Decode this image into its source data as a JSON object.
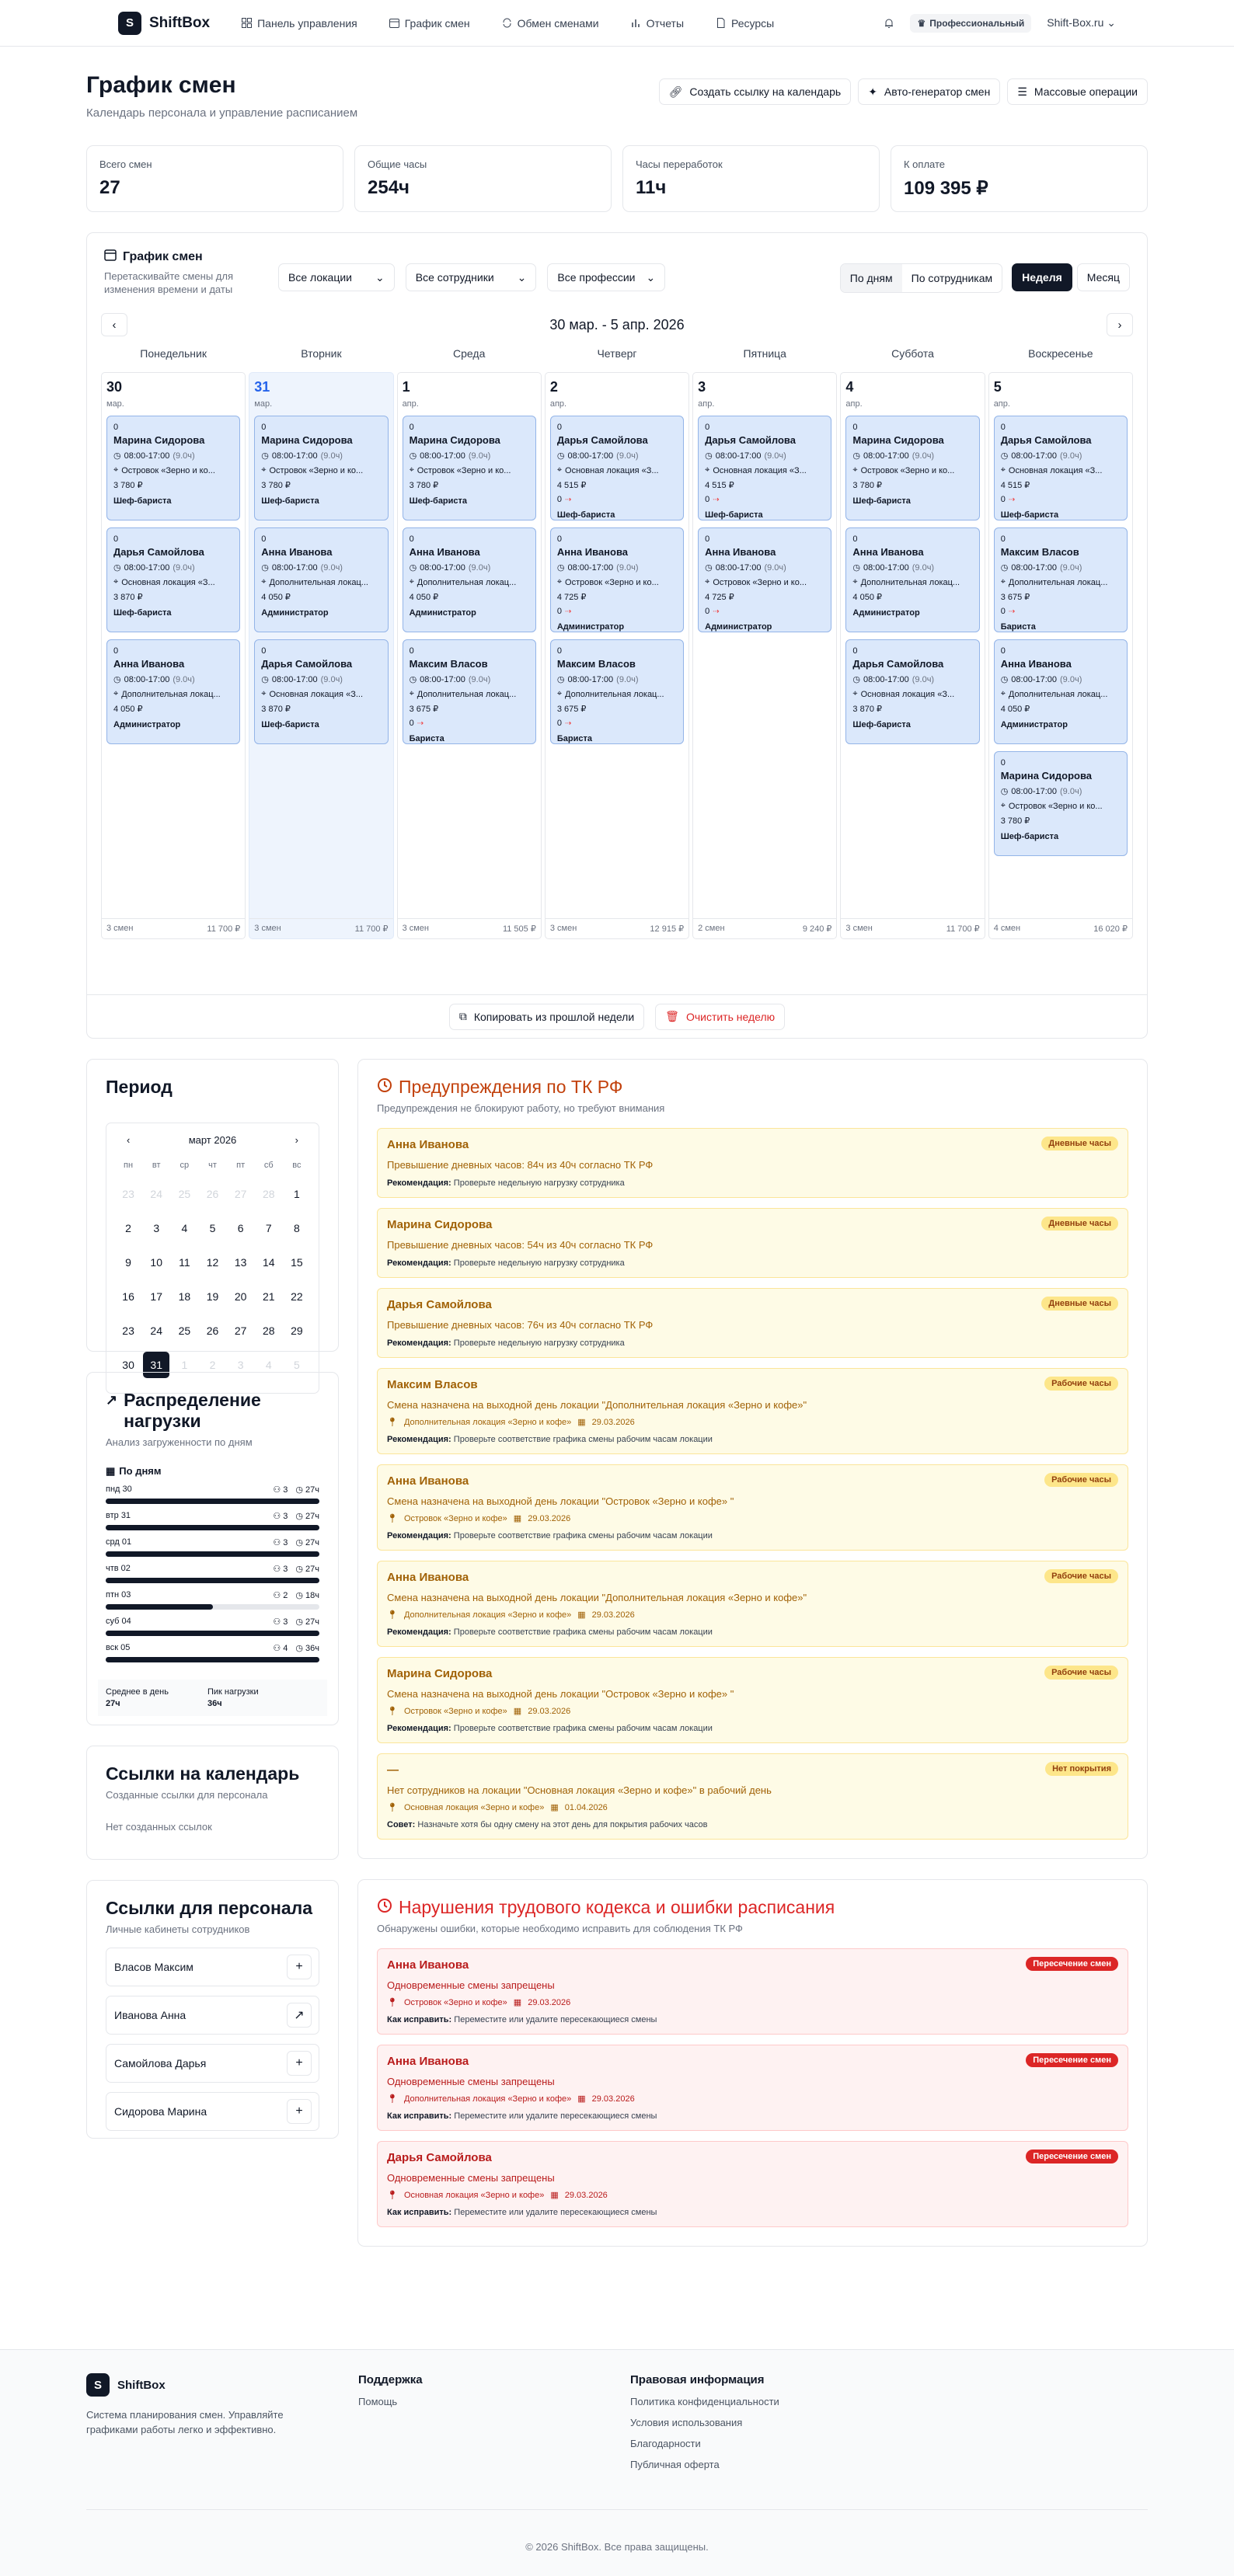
{
  "brand": {
    "name": "ShiftBox",
    "letter": "S"
  },
  "nav": [
    {
      "icon": "grid-icon",
      "label": "Панель управления"
    },
    {
      "icon": "calendar-icon",
      "label": "График смен"
    },
    {
      "icon": "swap-icon",
      "label": "Обмен сменами"
    },
    {
      "icon": "chart-icon",
      "label": "Отчеты"
    },
    {
      "icon": "doc-icon",
      "label": "Ресурсы"
    }
  ],
  "header": {
    "plan": "Профессиональный",
    "account": "Shift-Box.ru"
  },
  "page": {
    "title": "График смен",
    "subtitle": "Календарь персонала и управление расписанием"
  },
  "actions": {
    "link": "Создать ссылку на календарь",
    "generator": "Авто-генератор смен",
    "bulk": "Массовые операции"
  },
  "stats": [
    {
      "label": "Всего смен",
      "value": "27"
    },
    {
      "label": "Общие часы",
      "value": "254ч"
    },
    {
      "label": "Часы переработок",
      "value": "11ч"
    },
    {
      "label": "К оплате",
      "value": "109 395 ₽"
    }
  ],
  "schedule": {
    "title": "График смен",
    "desc": "Перетаскивайте смены для изменения времени и даты",
    "filters": {
      "locations": "Все локации",
      "staff": "Все сотрудники",
      "professions": "Все профессии"
    },
    "views": {
      "by_days": "По дням",
      "by_staff": "По сотрудникам",
      "week": "Неделя",
      "month": "Месяц"
    },
    "week_label": "30 мар. - 5 апр. 2026",
    "day_names": [
      "Понедельник",
      "Вторник",
      "Среда",
      "Четверг",
      "Пятница",
      "Суббота",
      "Воскресенье"
    ],
    "copy_label": "Копировать из прошлой недели",
    "clear_label": "Очистить неделю"
  },
  "days": [
    {
      "num": "30",
      "month": "мар.",
      "count": "3 смен",
      "total": "11 700 ₽",
      "shifts": [
        {
          "n": "0",
          "name": "Марина Сидорова",
          "time": "08:00-17:00",
          "dur": "(9.0ч)",
          "loc": "Островок «Зерно и ко...",
          "price": "3 780 ₽",
          "role": "Шеф-бариста"
        },
        {
          "n": "0",
          "name": "Дарья Самойлова",
          "time": "08:00-17:00",
          "dur": "(9.0ч)",
          "loc": "Основная локация «З...",
          "price": "3 870 ₽",
          "role": "Шеф-бариста"
        },
        {
          "n": "0",
          "name": "Анна Иванова",
          "time": "08:00-17:00",
          "dur": "(9.0ч)",
          "loc": "Дополнительная локац...",
          "price": "4 050 ₽",
          "role": "Администратор"
        }
      ]
    },
    {
      "num": "31",
      "month": "мар.",
      "count": "3 смен",
      "total": "11 700 ₽",
      "shifts": [
        {
          "n": "0",
          "name": "Марина Сидорова",
          "time": "08:00-17:00",
          "dur": "(9.0ч)",
          "loc": "Островок «Зерно и ко...",
          "price": "3 780 ₽",
          "role": "Шеф-бариста"
        },
        {
          "n": "0",
          "name": "Анна Иванова",
          "time": "08:00-17:00",
          "dur": "(9.0ч)",
          "loc": "Дополнительная локац...",
          "price": "4 050 ₽",
          "role": "Администратор"
        },
        {
          "n": "0",
          "name": "Дарья Самойлова",
          "time": "08:00-17:00",
          "dur": "(9.0ч)",
          "loc": "Основная локация «З...",
          "price": "3 870 ₽",
          "role": "Шеф-бариста"
        }
      ]
    },
    {
      "num": "1",
      "month": "апр.",
      "count": "3 смен",
      "total": "11 505 ₽",
      "shifts": [
        {
          "n": "0",
          "name": "Марина Сидорова",
          "time": "08:00-17:00",
          "dur": "(9.0ч)",
          "loc": "Островок «Зерно и ко...",
          "price": "3 780 ₽",
          "role": "Шеф-бариста"
        },
        {
          "n": "0",
          "name": "Анна Иванова",
          "time": "08:00-17:00",
          "dur": "(9.0ч)",
          "loc": "Дополнительная локац...",
          "price": "4 050 ₽",
          "role": "Администратор"
        },
        {
          "n": "0",
          "name": "Максим Власов",
          "time": "08:00-17:00",
          "dur": "(9.0ч)",
          "loc": "Дополнительная локац...",
          "price": "3 675 ₽",
          "extra": "0",
          "role": "Бариста"
        }
      ]
    },
    {
      "num": "2",
      "month": "апр.",
      "count": "3 смен",
      "total": "12 915 ₽",
      "shifts": [
        {
          "n": "0",
          "name": "Дарья Самойлова",
          "time": "08:00-17:00",
          "dur": "(9.0ч)",
          "loc": "Основная локация «З...",
          "price": "4 515 ₽",
          "extra": "0",
          "role": "Шеф-бариста"
        },
        {
          "n": "0",
          "name": "Анна Иванова",
          "time": "08:00-17:00",
          "dur": "(9.0ч)",
          "loc": "Островок «Зерно и ко...",
          "price": "4 725 ₽",
          "extra": "0",
          "role": "Администратор"
        },
        {
          "n": "0",
          "name": "Максим Власов",
          "time": "08:00-17:00",
          "dur": "(9.0ч)",
          "loc": "Дополнительная локац...",
          "price": "3 675 ₽",
          "extra": "0",
          "role": "Бариста"
        }
      ]
    },
    {
      "num": "3",
      "month": "апр.",
      "count": "2 смен",
      "total": "9 240 ₽",
      "shifts": [
        {
          "n": "0",
          "name": "Дарья Самойлова",
          "time": "08:00-17:00",
          "dur": "(9.0ч)",
          "loc": "Основная локация «З...",
          "price": "4 515 ₽",
          "extra": "0",
          "role": "Шеф-бариста"
        },
        {
          "n": "0",
          "name": "Анна Иванова",
          "time": "08:00-17:00",
          "dur": "(9.0ч)",
          "loc": "Островок «Зерно и ко...",
          "price": "4 725 ₽",
          "extra": "0",
          "role": "Администратор"
        }
      ]
    },
    {
      "num": "4",
      "month": "апр.",
      "count": "3 смен",
      "total": "11 700 ₽",
      "shifts": [
        {
          "n": "0",
          "name": "Марина Сидорова",
          "time": "08:00-17:00",
          "dur": "(9.0ч)",
          "loc": "Островок «Зерно и ко...",
          "price": "3 780 ₽",
          "role": "Шеф-бариста"
        },
        {
          "n": "0",
          "name": "Анна Иванова",
          "time": "08:00-17:00",
          "dur": "(9.0ч)",
          "loc": "Дополнительная локац...",
          "price": "4 050 ₽",
          "role": "Администратор"
        },
        {
          "n": "0",
          "name": "Дарья Самойлова",
          "time": "08:00-17:00",
          "dur": "(9.0ч)",
          "loc": "Основная локация «З...",
          "price": "3 870 ₽",
          "role": "Шеф-бариста"
        }
      ]
    },
    {
      "num": "5",
      "month": "апр.",
      "count": "4 смен",
      "total": "16 020 ₽",
      "shifts": [
        {
          "n": "0",
          "name": "Дарья Самойлова",
          "time": "08:00-17:00",
          "dur": "(9.0ч)",
          "loc": "Основная локация «З...",
          "price": "4 515 ₽",
          "extra": "0",
          "role": "Шеф-бариста"
        },
        {
          "n": "0",
          "name": "Максим Власов",
          "time": "08:00-17:00",
          "dur": "(9.0ч)",
          "loc": "Дополнительная локац...",
          "price": "3 675 ₽",
          "extra": "0",
          "role": "Бариста"
        },
        {
          "n": "0",
          "name": "Анна Иванова",
          "time": "08:00-17:00",
          "dur": "(9.0ч)",
          "loc": "Дополнительная локац...",
          "price": "4 050 ₽",
          "role": "Администратор"
        },
        {
          "n": "0",
          "name": "Марина Сидорова",
          "time": "08:00-17:00",
          "dur": "(9.0ч)",
          "loc": "Островок «Зерно и ко...",
          "price": "3 780 ₽",
          "role": "Шеф-бариста"
        }
      ]
    }
  ],
  "period": {
    "title": "Период",
    "month": "март 2026",
    "weekdays": [
      "пн",
      "вт",
      "ср",
      "чт",
      "пт",
      "сб",
      "вс"
    ],
    "cells": [
      {
        "d": "23",
        "dim": true
      },
      {
        "d": "24",
        "dim": true
      },
      {
        "d": "25",
        "dim": true
      },
      {
        "d": "26",
        "dim": true
      },
      {
        "d": "27",
        "dim": true
      },
      {
        "d": "28",
        "dim": true
      },
      {
        "d": "1"
      },
      {
        "d": "2"
      },
      {
        "d": "3"
      },
      {
        "d": "4"
      },
      {
        "d": "5"
      },
      {
        "d": "6"
      },
      {
        "d": "7"
      },
      {
        "d": "8"
      },
      {
        "d": "9"
      },
      {
        "d": "10"
      },
      {
        "d": "11"
      },
      {
        "d": "12"
      },
      {
        "d": "13"
      },
      {
        "d": "14"
      },
      {
        "d": "15"
      },
      {
        "d": "16"
      },
      {
        "d": "17"
      },
      {
        "d": "18"
      },
      {
        "d": "19"
      },
      {
        "d": "20"
      },
      {
        "d": "21"
      },
      {
        "d": "22"
      },
      {
        "d": "23"
      },
      {
        "d": "24"
      },
      {
        "d": "25"
      },
      {
        "d": "26"
      },
      {
        "d": "27"
      },
      {
        "d": "28"
      },
      {
        "d": "29"
      },
      {
        "d": "30"
      },
      {
        "d": "31",
        "active": true
      },
      {
        "d": "1",
        "dim": true
      },
      {
        "d": "2",
        "dim": true
      },
      {
        "d": "3",
        "dim": true
      },
      {
        "d": "4",
        "dim": true
      },
      {
        "d": "5",
        "dim": true
      }
    ]
  },
  "load": {
    "title": "Распределение нагрузки",
    "desc": "Анализ загруженности по дням",
    "by_days": "По дням",
    "rows": [
      {
        "day": "пнд 30",
        "people": "3",
        "hours": "27ч",
        "level": 1.0
      },
      {
        "day": "втр 31",
        "people": "3",
        "hours": "27ч",
        "level": 1.0
      },
      {
        "day": "срд 01",
        "people": "3",
        "hours": "27ч",
        "level": 1.0
      },
      {
        "day": "чтв 02",
        "people": "3",
        "hours": "27ч",
        "level": 1.0
      },
      {
        "day": "птн 03",
        "people": "2",
        "hours": "18ч",
        "level": 0.5
      },
      {
        "day": "суб 04",
        "people": "3",
        "hours": "27ч",
        "level": 1.0
      },
      {
        "day": "вск 05",
        "people": "4",
        "hours": "36ч",
        "level": 1.0
      }
    ],
    "avg_label": "Среднее в день",
    "avg_value": "27ч",
    "peak_label": "Пик нагрузки",
    "peak_value": "36ч"
  },
  "cal_links": {
    "title": "Ссылки на календарь",
    "desc": "Созданные ссылки для персонала",
    "empty": "Нет созданных ссылок"
  },
  "staff_links": {
    "title": "Ссылки для персонала",
    "desc": "Личные кабинеты сотрудников",
    "items": [
      {
        "name": "Власов Максим",
        "icon": "plus-icon",
        "glyph": "+"
      },
      {
        "name": "Иванова Анна",
        "icon": "external-link-icon",
        "glyph": "↗"
      },
      {
        "name": "Самойлова Дарья",
        "icon": "plus-icon",
        "glyph": "+"
      },
      {
        "name": "Сидорова Марина",
        "icon": "plus-icon",
        "glyph": "+"
      }
    ]
  },
  "warnings": {
    "title": "Предупреждения по ТК РФ",
    "desc": "Предупреждения не блокируют работу, но требуют внимания",
    "items": [
      {
        "name": "Анна Иванова",
        "badge": "Дневные часы",
        "msg": "Превышение дневных часов: 84ч из 40ч согласно ТК РФ",
        "rec_label": "Рекомендация:",
        "rec": "Проверьте недельную нагрузку сотрудника"
      },
      {
        "name": "Марина Сидорова",
        "badge": "Дневные часы",
        "msg": "Превышение дневных часов: 54ч из 40ч согласно ТК РФ",
        "rec_label": "Рекомендация:",
        "rec": "Проверьте недельную нагрузку сотрудника"
      },
      {
        "name": "Дарья Самойлова",
        "badge": "Дневные часы",
        "msg": "Превышение дневных часов: 76ч из 40ч согласно ТК РФ",
        "rec_label": "Рекомендация:",
        "rec": "Проверьте недельную нагрузку сотрудника"
      },
      {
        "name": "Максим Власов",
        "badge": "Рабочие часы",
        "msg": "Смена назначена на выходной день локации \"Дополнительная локация «Зерно и кофе»\"",
        "loc": "Дополнительная локация «Зерно и кофе»",
        "date": "29.03.2026",
        "rec_label": "Рекомендация:",
        "rec": "Проверьте соответствие графика смены рабочим часам локации"
      },
      {
        "name": "Анна Иванова",
        "badge": "Рабочие часы",
        "msg": "Смена назначена на выходной день локации \"Островок «Зерно и кофе» \"",
        "loc": "Островок «Зерно и кофе»",
        "date": "29.03.2026",
        "rec_label": "Рекомендация:",
        "rec": "Проверьте соответствие графика смены рабочим часам локации"
      },
      {
        "name": "Анна Иванова",
        "badge": "Рабочие часы",
        "msg": "Смена назначена на выходной день локации \"Дополнительная локация «Зерно и кофе»\"",
        "loc": "Дополнительная локация «Зерно и кофе»",
        "date": "29.03.2026",
        "rec_label": "Рекомендация:",
        "rec": "Проверьте соответствие графика смены рабочим часам локации"
      },
      {
        "name": "Марина Сидорова",
        "badge": "Рабочие часы",
        "msg": "Смена назначена на выходной день локации \"Островок «Зерно и кофе» \"",
        "loc": "Островок «Зерно и кофе»",
        "date": "29.03.2026",
        "rec_label": "Рекомендация:",
        "rec": "Проверьте соответствие графика смены рабочим часам локации"
      },
      {
        "name": "—",
        "badge": "Нет покрытия",
        "msg": "Нет сотрудников на локации \"Основная локация «Зерно и кофе»\" в рабочий день",
        "loc": "Основная локация «Зерно и кофе»",
        "date": "01.04.2026",
        "rec_label": "Совет:",
        "rec": "Назначьте хотя бы одну смену на этот день для покрытия рабочих часов"
      }
    ]
  },
  "violations": {
    "title": "Нарушения трудового кодекса и ошибки расписания",
    "desc": "Обнаружены ошибки, которые необходимо исправить для соблюдения ТК РФ",
    "items": [
      {
        "name": "Анна Иванова",
        "badge": "Пересечение смен",
        "msg": "Одновременные смены запрещены",
        "loc": "Островок «Зерно и кофе»",
        "date": "29.03.2026",
        "fix_label": "Как исправить:",
        "fix": "Переместите или удалите пересекающиеся смены"
      },
      {
        "name": "Анна Иванова",
        "badge": "Пересечение смен",
        "msg": "Одновременные смены запрещены",
        "loc": "Дополнительная локация «Зерно и кофе»",
        "date": "29.03.2026",
        "fix_label": "Как исправить:",
        "fix": "Переместите или удалите пересекающиеся смены"
      },
      {
        "name": "Дарья Самойлова",
        "badge": "Пересечение смен",
        "msg": "Одновременные смены запрещены",
        "loc": "Основная локация «Зерно и кофе»",
        "date": "29.03.2026",
        "fix_label": "Как исправить:",
        "fix": "Переместите или удалите пересекающиеся смены"
      }
    ]
  },
  "footer": {
    "desc": "Система планирования смен. Управляйте графиками работы легко и эффективно.",
    "support_h": "Поддержка",
    "support": [
      "Помощь"
    ],
    "legal_h": "Правовая информация",
    "legal": [
      "Политика конфиденциальности",
      "Условия использования",
      "Благодарности",
      "Публичная оферта"
    ],
    "copyright": "© 2026 ShiftBox. Все права защищены."
  },
  "colors": {
    "accent": "#111827",
    "today": "#2563eb",
    "shift_bg": "#dbe8fb",
    "warning": "#a16207",
    "error": "#dc2626"
  }
}
